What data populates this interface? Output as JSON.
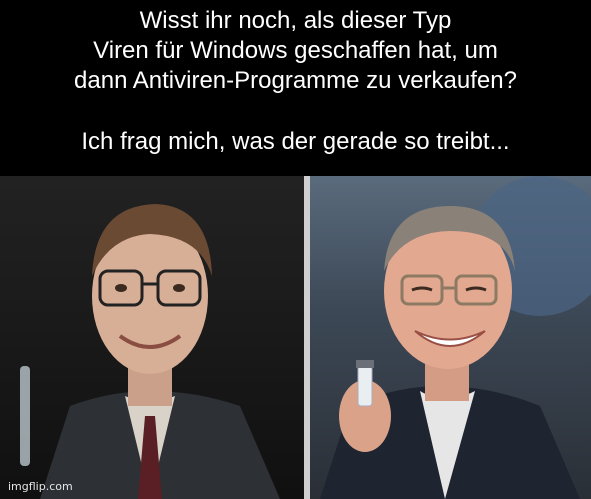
{
  "caption": {
    "line1": "Wisst ihr noch, als dieser Typ",
    "line2": "Viren für Windows geschaffen hat, um",
    "line3": "dann Antiviren-Programme zu verkaufen?",
    "line4": "Ich frag mich, was der gerade so treibt..."
  },
  "photos": {
    "left_label": "young-man-with-glasses-photo",
    "right_label": "older-man-with-vaccine-vial-photo"
  },
  "watermark": "imgflip.com"
}
